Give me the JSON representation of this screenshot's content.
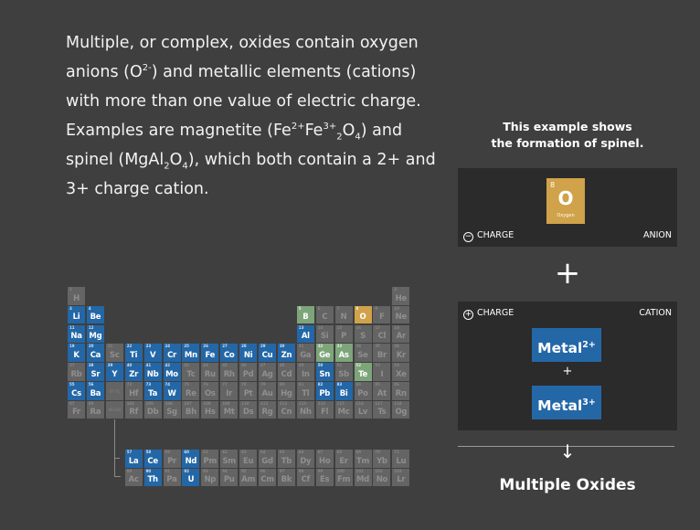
{
  "intro": {
    "p1": "Multiple, or complex, oxides contain oxygen anions (O",
    "p1_sup": "2-",
    "p2": ") and metallic elements (cations) with more than one value of electric charge. Examples are magnetite (Fe",
    "fe2": "2+",
    "p3": "Fe",
    "fe3": "3+",
    "sub2a": "2",
    "p4": "O",
    "sub4a": "4",
    "p5": ") and spinel (MgAl",
    "sub2b": "2",
    "p6": "O",
    "sub4b": "4",
    "p7": "), which both contain a 2+ and 3+ charge cation."
  },
  "caption": {
    "line1": "This example shows",
    "line2": "the formation of spinel."
  },
  "anion_panel": {
    "element_number": "8",
    "element_symbol": "O",
    "element_name": "Oxygen",
    "charge_symbol": "−",
    "charge_label": "CHARGE",
    "type_label": "ANION"
  },
  "plus": "+",
  "cation_panel": {
    "charge_symbol": "+",
    "charge_label": "CHARGE",
    "type_label": "CATION",
    "metal1": "Metal",
    "metal1_charge": "2+",
    "metal2": "Metal",
    "metal2_charge": "3+",
    "inner_plus": "+"
  },
  "arrow": "↓",
  "result": "Multiple Oxides",
  "colors": {
    "metal": "#2467a7",
    "oxygen": "#d0a24a",
    "semimetal": "#7ea57a",
    "inactive": "#646464"
  },
  "periodic_table": {
    "rows": [
      [
        [
          "1",
          "H",
          ""
        ],
        null,
        null,
        null,
        null,
        null,
        null,
        null,
        null,
        null,
        null,
        null,
        null,
        null,
        null,
        null,
        null,
        [
          "2",
          "He",
          ""
        ]
      ],
      [
        [
          "3",
          "Li",
          "m"
        ],
        [
          "4",
          "Be",
          "m"
        ],
        null,
        null,
        null,
        null,
        null,
        null,
        null,
        null,
        null,
        null,
        [
          "5",
          "B",
          "s"
        ],
        [
          "6",
          "C",
          ""
        ],
        [
          "7",
          "N",
          ""
        ],
        [
          "8",
          "O",
          "o"
        ],
        [
          "9",
          "F",
          ""
        ],
        [
          "10",
          "Ne",
          ""
        ]
      ],
      [
        [
          "11",
          "Na",
          "m"
        ],
        [
          "12",
          "Mg",
          "m"
        ],
        null,
        null,
        null,
        null,
        null,
        null,
        null,
        null,
        null,
        null,
        [
          "13",
          "Al",
          "m"
        ],
        [
          "14",
          "Si",
          ""
        ],
        [
          "15",
          "P",
          ""
        ],
        [
          "16",
          "S",
          ""
        ],
        [
          "17",
          "Cl",
          ""
        ],
        [
          "18",
          "Ar",
          ""
        ]
      ],
      [
        [
          "19",
          "K",
          "m"
        ],
        [
          "20",
          "Ca",
          "m"
        ],
        [
          "21",
          "Sc",
          ""
        ],
        [
          "22",
          "Ti",
          "m"
        ],
        [
          "23",
          "V",
          "m"
        ],
        [
          "24",
          "Cr",
          "m"
        ],
        [
          "25",
          "Mn",
          "m"
        ],
        [
          "26",
          "Fe",
          "m"
        ],
        [
          "27",
          "Co",
          "m"
        ],
        [
          "28",
          "Ni",
          "m"
        ],
        [
          "29",
          "Cu",
          "m"
        ],
        [
          "30",
          "Zn",
          "m"
        ],
        [
          "31",
          "Ga",
          ""
        ],
        [
          "32",
          "Ge",
          "s"
        ],
        [
          "33",
          "As",
          "s"
        ],
        [
          "34",
          "Se",
          ""
        ],
        [
          "35",
          "Br",
          ""
        ],
        [
          "36",
          "Kr",
          ""
        ]
      ],
      [
        [
          "37",
          "Rb",
          ""
        ],
        [
          "38",
          "Sr",
          "m"
        ],
        [
          "39",
          "Y",
          "m"
        ],
        [
          "40",
          "Zr",
          "m"
        ],
        [
          "41",
          "Nb",
          "m"
        ],
        [
          "42",
          "Mo",
          "m"
        ],
        [
          "43",
          "Tc",
          ""
        ],
        [
          "44",
          "Ru",
          ""
        ],
        [
          "45",
          "Rh",
          ""
        ],
        [
          "46",
          "Pd",
          ""
        ],
        [
          "47",
          "Ag",
          ""
        ],
        [
          "48",
          "Cd",
          ""
        ],
        [
          "49",
          "In",
          ""
        ],
        [
          "50",
          "Sn",
          "m"
        ],
        [
          "51",
          "Sb",
          ""
        ],
        [
          "52",
          "Te",
          "s"
        ],
        [
          "53",
          "I",
          ""
        ],
        [
          "54",
          "Xe",
          ""
        ]
      ],
      [
        [
          "55",
          "Cs",
          "m"
        ],
        [
          "56",
          "Ba",
          "m"
        ],
        [
          "",
          "57-71",
          "p"
        ],
        [
          "72",
          "Hf",
          ""
        ],
        [
          "73",
          "Ta",
          "m"
        ],
        [
          "74",
          "W",
          "m"
        ],
        [
          "75",
          "Re",
          ""
        ],
        [
          "76",
          "Os",
          ""
        ],
        [
          "77",
          "Ir",
          ""
        ],
        [
          "78",
          "Pt",
          ""
        ],
        [
          "79",
          "Au",
          ""
        ],
        [
          "80",
          "Hg",
          ""
        ],
        [
          "81",
          "Tl",
          ""
        ],
        [
          "82",
          "Pb",
          "m"
        ],
        [
          "83",
          "Bi",
          "m"
        ],
        [
          "84",
          "Po",
          ""
        ],
        [
          "85",
          "At",
          ""
        ],
        [
          "86",
          "Rn",
          ""
        ]
      ],
      [
        [
          "87",
          "Fr",
          ""
        ],
        [
          "88",
          "Ra",
          ""
        ],
        [
          "",
          "89-103",
          "p"
        ],
        [
          "104",
          "Rf",
          ""
        ],
        [
          "105",
          "Db",
          ""
        ],
        [
          "106",
          "Sg",
          ""
        ],
        [
          "107",
          "Bh",
          ""
        ],
        [
          "108",
          "Hs",
          ""
        ],
        [
          "109",
          "Mt",
          ""
        ],
        [
          "110",
          "Ds",
          ""
        ],
        [
          "111",
          "Rg",
          ""
        ],
        [
          "112",
          "Cn",
          ""
        ],
        [
          "113",
          "Nh",
          ""
        ],
        [
          "114",
          "Fl",
          ""
        ],
        [
          "115",
          "Mc",
          ""
        ],
        [
          "116",
          "Lv",
          ""
        ],
        [
          "117",
          "Ts",
          ""
        ],
        [
          "118",
          "Og",
          ""
        ]
      ]
    ],
    "lanthanides": [
      [
        "57",
        "La",
        "m"
      ],
      [
        "58",
        "Ce",
        "m"
      ],
      [
        "59",
        "Pr",
        ""
      ],
      [
        "60",
        "Nd",
        "m"
      ],
      [
        "61",
        "Pm",
        ""
      ],
      [
        "62",
        "Sm",
        ""
      ],
      [
        "63",
        "Eu",
        ""
      ],
      [
        "64",
        "Gd",
        ""
      ],
      [
        "65",
        "Tb",
        ""
      ],
      [
        "66",
        "Dy",
        ""
      ],
      [
        "67",
        "Ho",
        ""
      ],
      [
        "68",
        "Er",
        ""
      ],
      [
        "69",
        "Tm",
        ""
      ],
      [
        "70",
        "Yb",
        ""
      ],
      [
        "71",
        "Lu",
        ""
      ]
    ],
    "actinides": [
      [
        "89",
        "Ac",
        ""
      ],
      [
        "90",
        "Th",
        "m"
      ],
      [
        "91",
        "Pa",
        ""
      ],
      [
        "92",
        "U",
        "m"
      ],
      [
        "93",
        "Np",
        ""
      ],
      [
        "94",
        "Pu",
        ""
      ],
      [
        "95",
        "Am",
        ""
      ],
      [
        "96",
        "Cm",
        ""
      ],
      [
        "97",
        "Bk",
        ""
      ],
      [
        "98",
        "Cf",
        ""
      ],
      [
        "99",
        "Es",
        ""
      ],
      [
        "100",
        "Fm",
        ""
      ],
      [
        "101",
        "Md",
        ""
      ],
      [
        "102",
        "No",
        ""
      ],
      [
        "103",
        "Lr",
        ""
      ]
    ]
  }
}
